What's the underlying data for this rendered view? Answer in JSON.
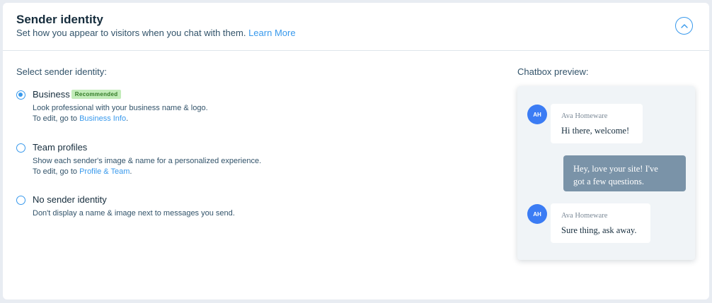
{
  "header": {
    "title": "Sender identity",
    "subtitle": "Set how you appear to visitors when you chat with them.",
    "learn_more": "Learn More",
    "collapse_icon": "chevron-up-icon"
  },
  "section_label": "Select sender identity:",
  "options": [
    {
      "label": "Business",
      "badge": "Recommended",
      "selected": true,
      "desc_line1": "Look professional with your business name & logo.",
      "desc_prefix": "To edit, go to",
      "desc_link": "Business Info",
      "desc_suffix": "."
    },
    {
      "label": "Team profiles",
      "selected": false,
      "desc_line1": "Show each sender's image & name for a personalized experience.",
      "desc_prefix": "To edit, go to",
      "desc_link": "Profile & Team",
      "desc_suffix": "."
    },
    {
      "label": "No sender identity",
      "selected": false,
      "desc_line1": "Don't display a name & image next to messages you send."
    }
  ],
  "preview": {
    "label": "Chatbox preview:",
    "messages": [
      {
        "avatar": "AH",
        "sender": "Ava Homeware",
        "text": "Hi there, welcome!"
      },
      {
        "text_line1": "Hey, love your site! I've",
        "text_line2": "got a few questions."
      },
      {
        "avatar": "AH",
        "sender": "Ava Homeware",
        "text": "Sure thing, ask away."
      }
    ]
  },
  "colors": {
    "accent": "#3899ec",
    "badge_bg": "#c2ecb9",
    "badge_text": "#327a27",
    "avatar": "#3b7cf4",
    "outgoing_bubble": "#7a93a8"
  }
}
